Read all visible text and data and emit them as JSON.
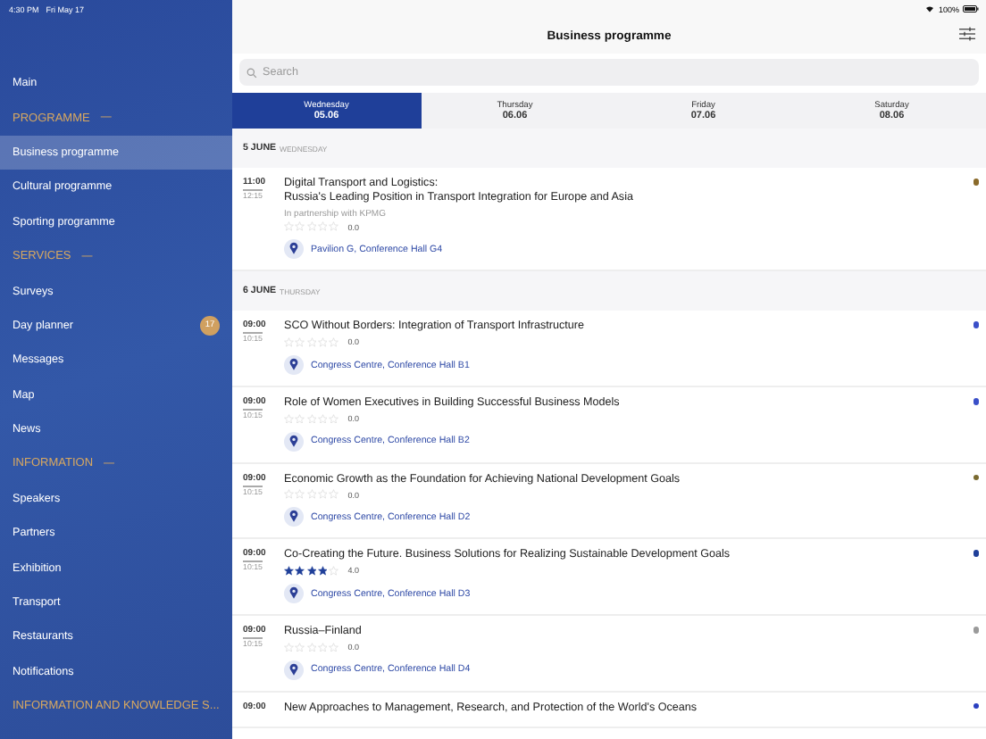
{
  "status_bar": {
    "time": "4:30 PM",
    "date": "Fri May 17",
    "battery": "100%"
  },
  "sidebar": {
    "items": [
      {
        "kind": "item",
        "label": "Main",
        "selected": false
      },
      {
        "kind": "header",
        "label": "PROGRAMME",
        "collapse": "—"
      },
      {
        "kind": "item",
        "label": "Business programme",
        "selected": true
      },
      {
        "kind": "item",
        "label": "Cultural programme",
        "selected": false
      },
      {
        "kind": "item",
        "label": "Sporting programme",
        "selected": false
      },
      {
        "kind": "header",
        "label": "SERVICES",
        "collapse": "—"
      },
      {
        "kind": "item",
        "label": "Surveys",
        "selected": false
      },
      {
        "kind": "item",
        "label": "Day planner",
        "selected": false,
        "badge": "17"
      },
      {
        "kind": "item",
        "label": "Messages",
        "selected": false
      },
      {
        "kind": "item",
        "label": "Map",
        "selected": false
      },
      {
        "kind": "item",
        "label": "News",
        "selected": false
      },
      {
        "kind": "header",
        "label": "INFORMATION",
        "collapse": "—"
      },
      {
        "kind": "item",
        "label": "Speakers",
        "selected": false
      },
      {
        "kind": "item",
        "label": "Partners",
        "selected": false
      },
      {
        "kind": "item",
        "label": "Exhibition",
        "selected": false
      },
      {
        "kind": "item",
        "label": "Transport",
        "selected": false
      },
      {
        "kind": "item",
        "label": "Restaurants",
        "selected": false
      },
      {
        "kind": "item",
        "label": "Notifications",
        "selected": false
      },
      {
        "kind": "header",
        "label": "INFORMATION AND KNOWLEDGE S..."
      }
    ]
  },
  "header": {
    "title": "Business programme"
  },
  "search": {
    "placeholder": "Search"
  },
  "tabs": [
    {
      "day": "Wednesday",
      "date": "05.06",
      "selected": true
    },
    {
      "day": "Thursday",
      "date": "06.06",
      "selected": false
    },
    {
      "day": "Friday",
      "date": "07.06",
      "selected": false
    },
    {
      "day": "Saturday",
      "date": "08.06",
      "selected": false
    }
  ],
  "sections": [
    {
      "date": "5 JUNE",
      "weekday": "WEDNESDAY",
      "events": [
        {
          "start": "11:00",
          "end": "12:15",
          "title": "Digital Transport and Logistics:\nRussia's Leading Position in Transport Integration for Europe and Asia",
          "partner": "In partnership with KPMG",
          "stars": 0,
          "rating": "0.0",
          "location": "Pavilion G, Conference Hall G4",
          "color": "#8a6a2a"
        }
      ]
    },
    {
      "date": "6 JUNE",
      "weekday": "THURSDAY",
      "events": [
        {
          "start": "09:00",
          "end": "10:15",
          "title": "SCO Without Borders: Integration of Transport Infrastructure",
          "stars": 0,
          "rating": "0.0",
          "location": "Congress Centre, Conference Hall B1",
          "color": "#3a4fc8"
        },
        {
          "start": "09:00",
          "end": "10:15",
          "title": "Role of Women Executives in Building Successful Business Models",
          "stars": 0,
          "rating": "0.0",
          "location": "Congress Centre, Conference Hall B2",
          "color": "#3a4fc8"
        },
        {
          "start": "09:00",
          "end": "10:15",
          "title": "Economic Growth as the Foundation for Achieving National Development Goals",
          "stars": 0,
          "rating": "0.0",
          "location": "Congress Centre, Conference Hall D2",
          "color": "#7a6a30"
        },
        {
          "start": "09:00",
          "end": "10:15",
          "title": "Co-Creating the Future. Business Solutions for Realizing Sustainable Development Goals",
          "stars": 4,
          "rating": "4.0",
          "location": "Congress Centre, Conference Hall D3",
          "color": "#1f3f99"
        },
        {
          "start": "09:00",
          "end": "10:15",
          "title": "Russia–Finland",
          "stars": 0,
          "rating": "0.0",
          "location": "Congress Centre, Conference Hall D4",
          "color": "#9a9a9a"
        },
        {
          "start": "09:00",
          "title": "New Approaches to Management, Research, and Protection of the World's Oceans",
          "color": "#2a3fc0"
        }
      ]
    }
  ]
}
